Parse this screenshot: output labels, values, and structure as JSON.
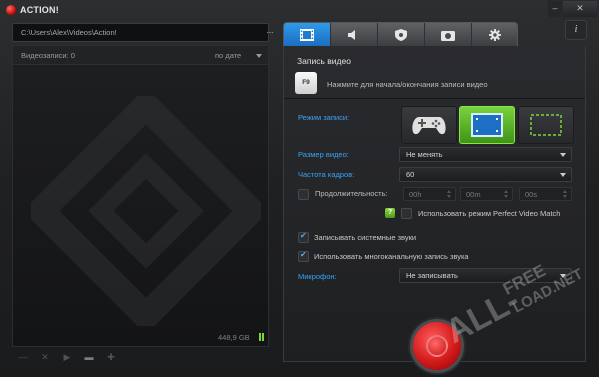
{
  "app": {
    "title": "ACTION!",
    "minimize_glyph": "–",
    "close_glyph": "✕",
    "logo_icon": "red-record-dot"
  },
  "left": {
    "path": "C:\\Users\\Alex\\Videos\\Action!",
    "browse_label": "...",
    "list_title": "Видеозаписи: 0",
    "sort_label": "по дате",
    "free_space": "448,9 GB",
    "tools": [
      {
        "name": "delete",
        "glyph": "—"
      },
      {
        "name": "close",
        "glyph": "✕"
      },
      {
        "name": "play",
        "glyph": "▶"
      },
      {
        "name": "folder",
        "glyph": "▬"
      },
      {
        "name": "add",
        "glyph": "✚"
      }
    ]
  },
  "tabs": [
    {
      "name": "video",
      "icon": "film-icon",
      "active": true
    },
    {
      "name": "audio",
      "icon": "speaker-icon",
      "active": false
    },
    {
      "name": "benchmark",
      "icon": "shield-icon",
      "active": false
    },
    {
      "name": "screenshot",
      "icon": "camera-icon",
      "active": false
    },
    {
      "name": "settings",
      "icon": "gear-icon",
      "active": false
    }
  ],
  "help_label": "i",
  "video": {
    "section_title": "Запись видео",
    "hotkey": "F9",
    "hotkey_hint": "Нажмите для начала/окончания записи видео",
    "mode_label": "Режим записи:",
    "modes": [
      "gamepad",
      "fullscreen",
      "region"
    ],
    "active_mode": "fullscreen",
    "size_label": "Размер видео:",
    "size_value": "Не менять",
    "fps_label": "Частота кадров:",
    "fps_value": "60",
    "duration_label": "Продолжительность:",
    "duration_h": "00h",
    "duration_m": "00m",
    "duration_s": "00s",
    "perfect_match_label": "Использовать режим Perfect Video Match",
    "help_q": "?",
    "system_sound_label": "Записывать системные звуки",
    "multichannel_label": "Использовать многоканальную запись звука",
    "mic_label": "Микрофон:",
    "mic_value": "Не записывать"
  },
  "watermark": {
    "line1": "ALL-",
    "line2": "FREE",
    "line3": "LOAD.NET"
  },
  "colors": {
    "accent_blue": "#3ba3f5",
    "active_green": "#78d23c",
    "record_red": "#d21a1a"
  }
}
